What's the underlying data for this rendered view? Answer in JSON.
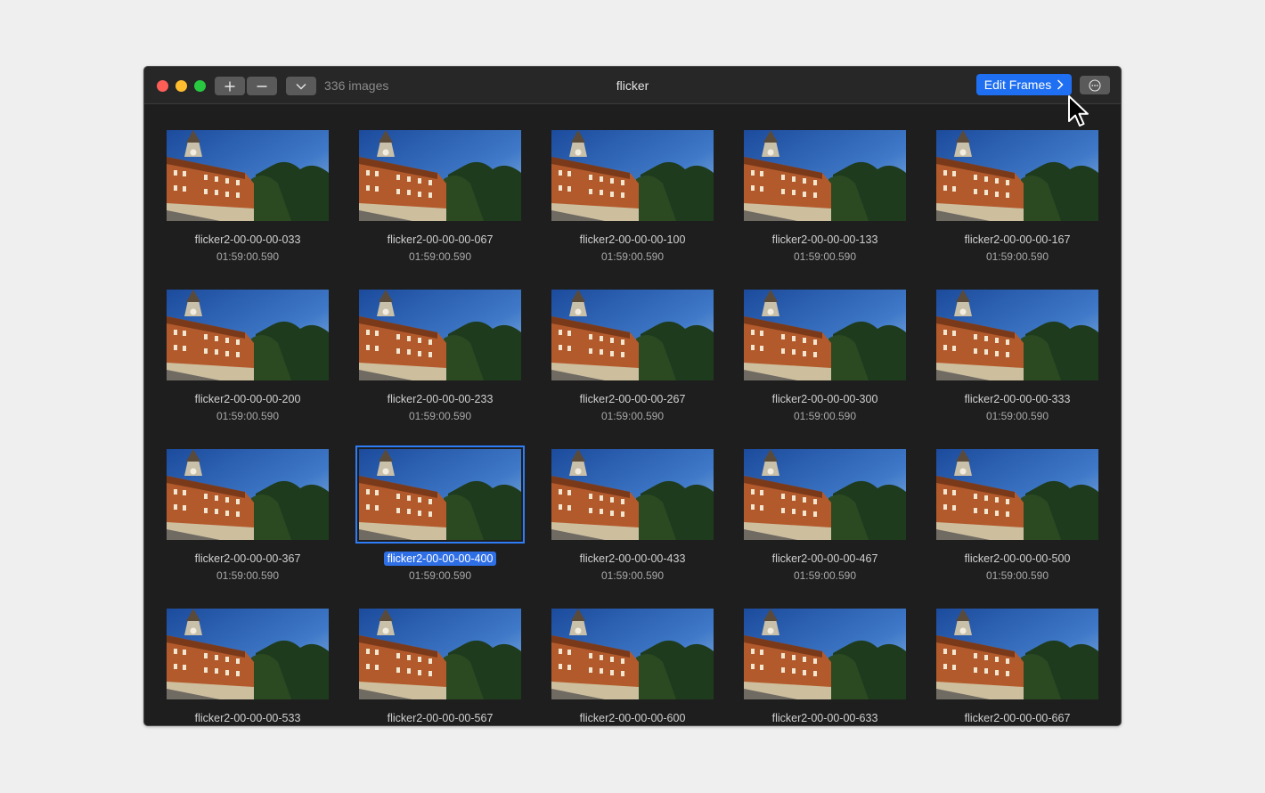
{
  "window": {
    "title": "flicker",
    "image_count_label": "336 images",
    "edit_button_label": "Edit Frames",
    "toolbar_icons": [
      "plus-icon",
      "minus-icon",
      "chevron-down-icon",
      "more-icon"
    ]
  },
  "colors": {
    "accent": "#1f6ff2",
    "selection": "#2f6fe6",
    "window_bg": "#1e1e1e"
  },
  "frames": [
    {
      "name": "flicker2-00-00-00-033",
      "time": "01:59:00.590",
      "selected": false
    },
    {
      "name": "flicker2-00-00-00-067",
      "time": "01:59:00.590",
      "selected": false
    },
    {
      "name": "flicker2-00-00-00-100",
      "time": "01:59:00.590",
      "selected": false
    },
    {
      "name": "flicker2-00-00-00-133",
      "time": "01:59:00.590",
      "selected": false
    },
    {
      "name": "flicker2-00-00-00-167",
      "time": "01:59:00.590",
      "selected": false
    },
    {
      "name": "flicker2-00-00-00-200",
      "time": "01:59:00.590",
      "selected": false
    },
    {
      "name": "flicker2-00-00-00-233",
      "time": "01:59:00.590",
      "selected": false
    },
    {
      "name": "flicker2-00-00-00-267",
      "time": "01:59:00.590",
      "selected": false
    },
    {
      "name": "flicker2-00-00-00-300",
      "time": "01:59:00.590",
      "selected": false
    },
    {
      "name": "flicker2-00-00-00-333",
      "time": "01:59:00.590",
      "selected": false
    },
    {
      "name": "flicker2-00-00-00-367",
      "time": "01:59:00.590",
      "selected": false
    },
    {
      "name": "flicker2-00-00-00-400",
      "time": "01:59:00.590",
      "selected": true
    },
    {
      "name": "flicker2-00-00-00-433",
      "time": "01:59:00.590",
      "selected": false
    },
    {
      "name": "flicker2-00-00-00-467",
      "time": "01:59:00.590",
      "selected": false
    },
    {
      "name": "flicker2-00-00-00-500",
      "time": "01:59:00.590",
      "selected": false
    },
    {
      "name": "flicker2-00-00-00-533",
      "time": "",
      "selected": false
    },
    {
      "name": "flicker2-00-00-00-567",
      "time": "",
      "selected": false
    },
    {
      "name": "flicker2-00-00-00-600",
      "time": "",
      "selected": false
    },
    {
      "name": "flicker2-00-00-00-633",
      "time": "",
      "selected": false
    },
    {
      "name": "flicker2-00-00-00-667",
      "time": "",
      "selected": false
    }
  ]
}
